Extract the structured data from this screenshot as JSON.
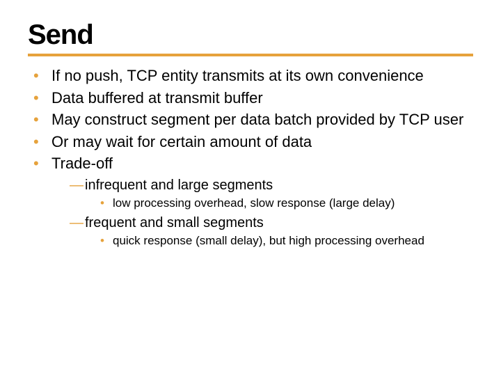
{
  "title": "Send",
  "bullets": {
    "b1": "If no push, TCP entity transmits at its own convenience",
    "b2": "Data buffered at transmit buffer",
    "b3": "May construct segment per data batch provided by TCP user",
    "b4": "Or may wait for certain amount of data",
    "b5": "Trade-off",
    "sub": {
      "s1": "infrequent and large segments",
      "s1_1": "low processing overhead, slow response (large delay)",
      "s2": "frequent and small segments",
      "s2_1": "quick response (small delay), but high processing overhead"
    }
  }
}
